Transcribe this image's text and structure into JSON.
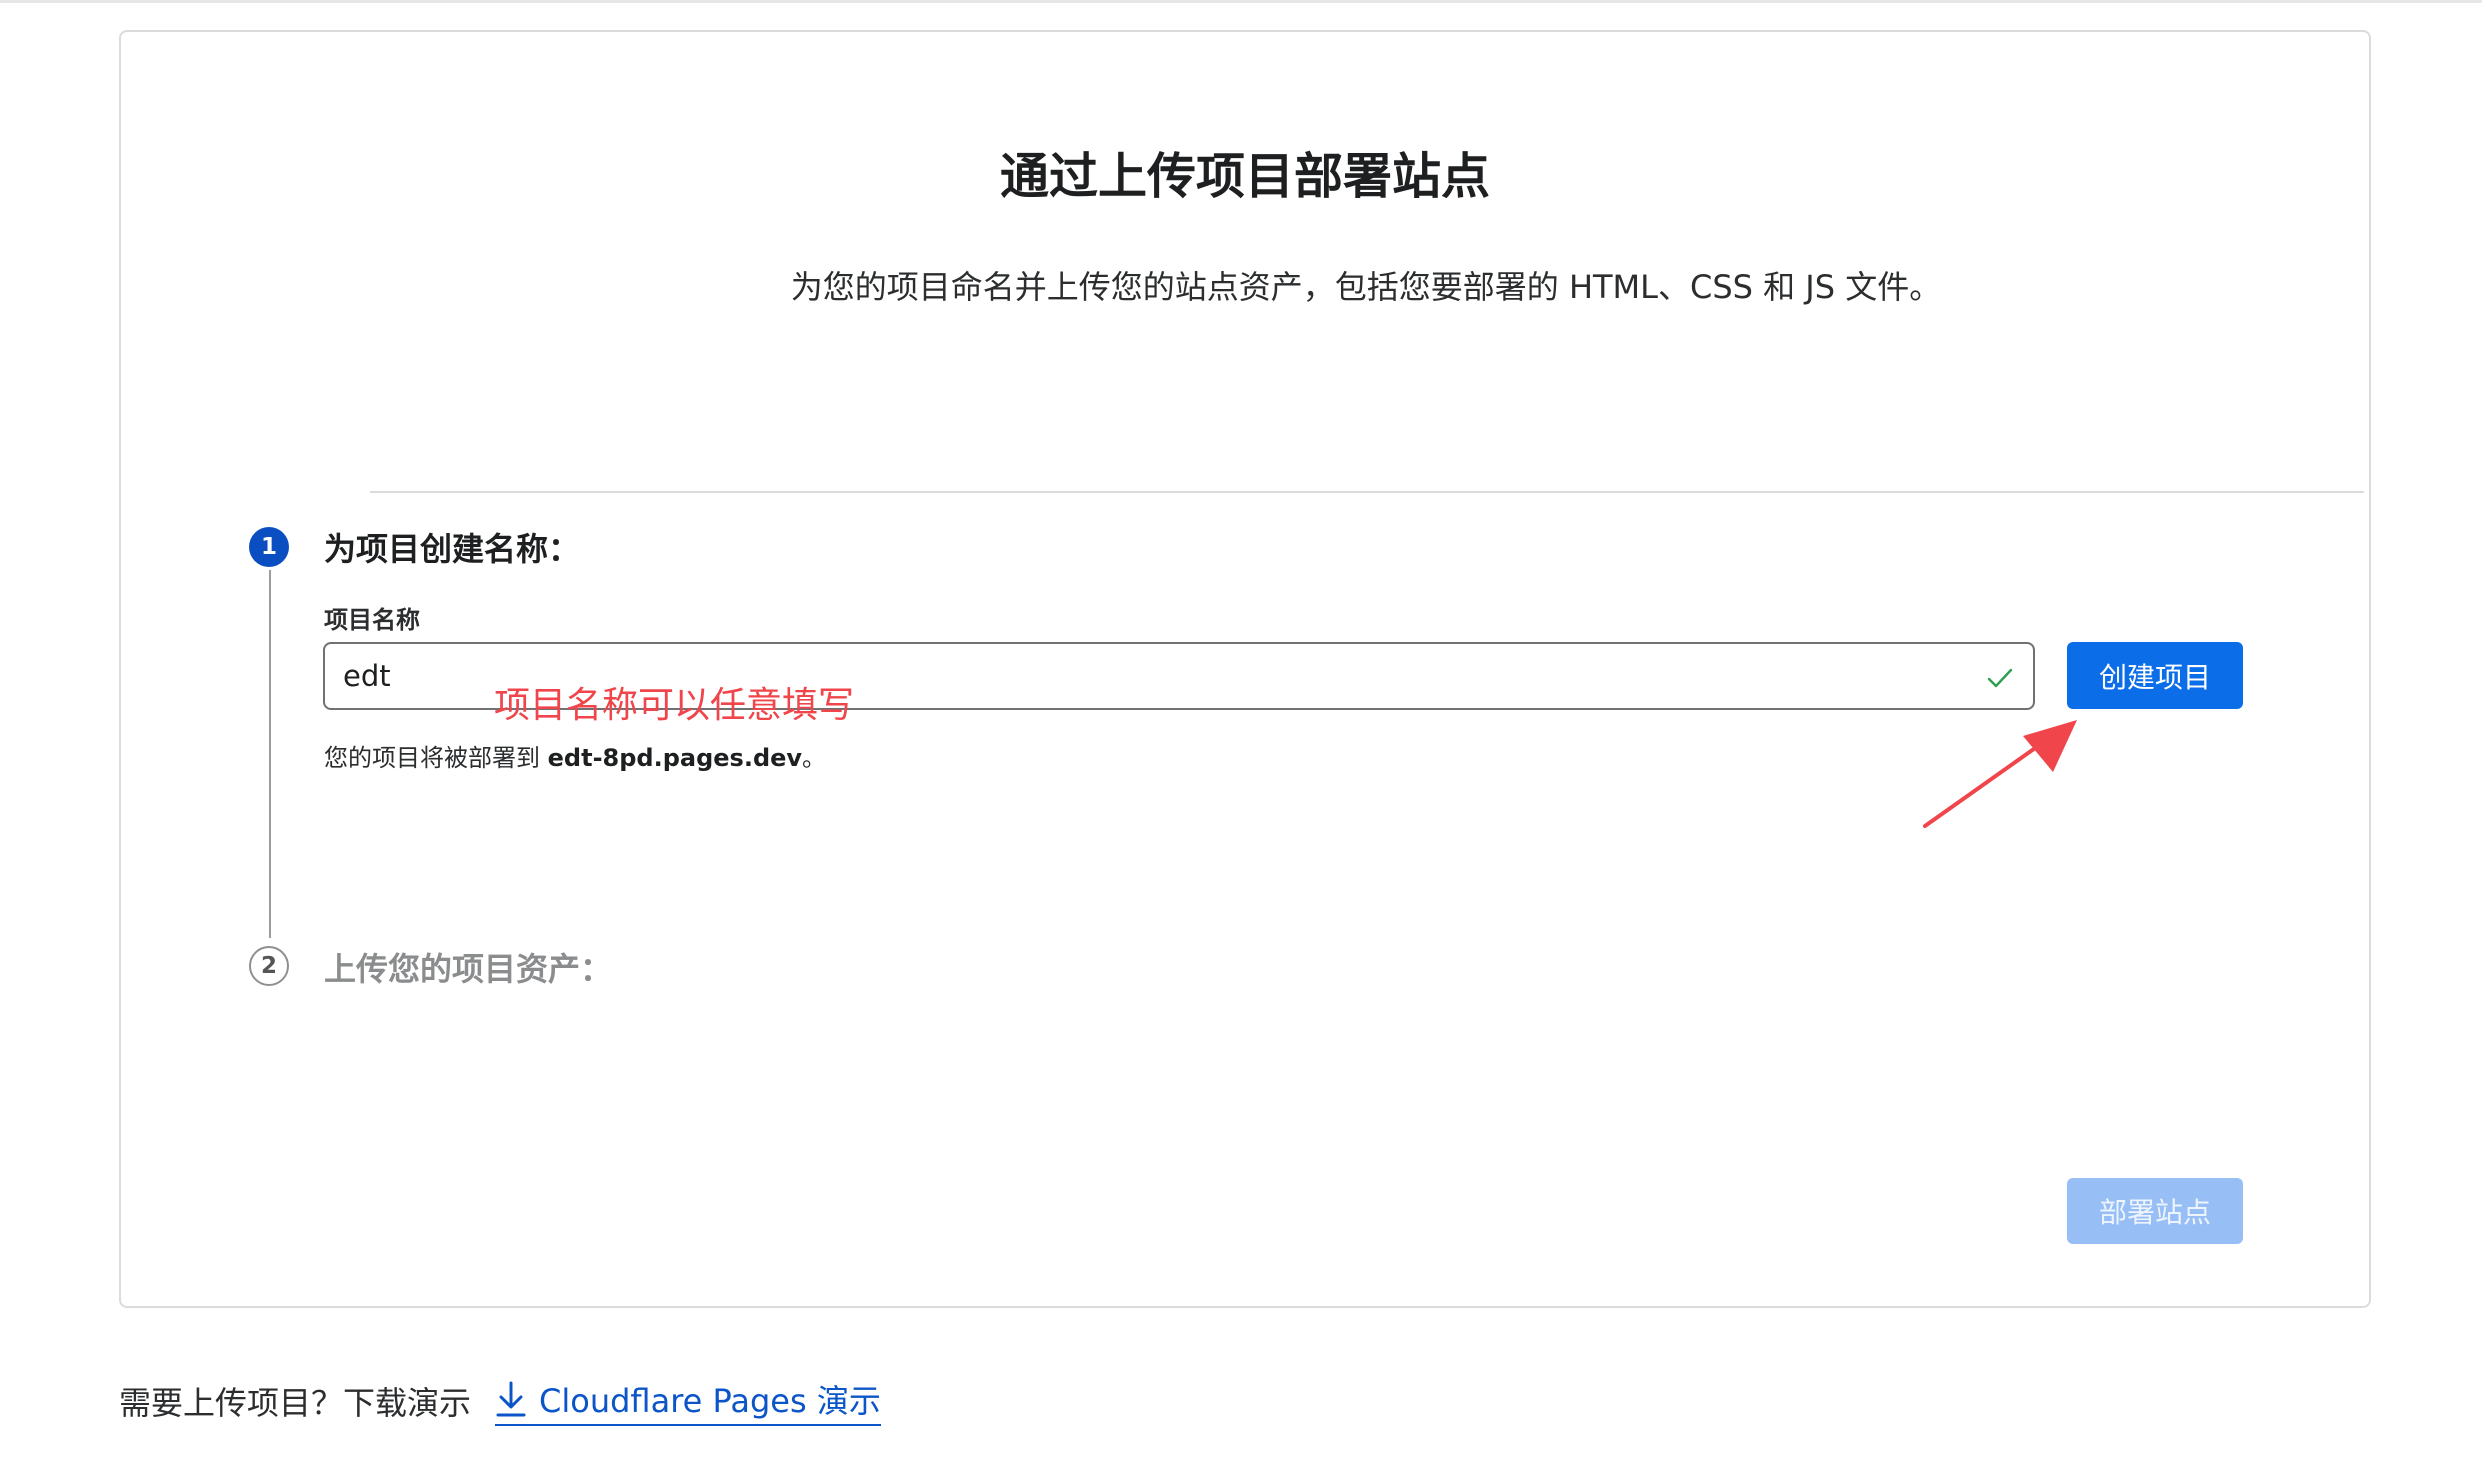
{
  "header": {
    "title": "通过上传项目部署站点",
    "description": "为您的项目命名并上传您的站点资产，包括您要部署的 HTML、CSS 和 JS 文件。"
  },
  "step1": {
    "number": "1",
    "title": "为项目创建名称：",
    "field_label": "项目名称",
    "input_value": "edt",
    "create_button": "创建项目",
    "hint_prefix": "您的项目将被部署到 ",
    "hint_domain": "edt-8pd.pages.dev",
    "hint_suffix": "。"
  },
  "annotation": {
    "text": "项目名称可以任意填写",
    "color": "#f0454b"
  },
  "step2": {
    "number": "2",
    "title": "上传您的项目资产："
  },
  "deploy_button": "部署站点",
  "footer": {
    "prompt": "需要上传项目？下载演示",
    "link_text": "Cloudflare Pages 演示"
  },
  "icons": {
    "valid": "check-icon",
    "download": "download-icon",
    "annotation_arrow": "arrow-icon"
  },
  "colors": {
    "primary": "#0b6ee8",
    "step_active": "#0b4ec2",
    "link": "#0b55c8",
    "disabled_button": "#97bff5",
    "valid_check": "#2e9e4f"
  }
}
